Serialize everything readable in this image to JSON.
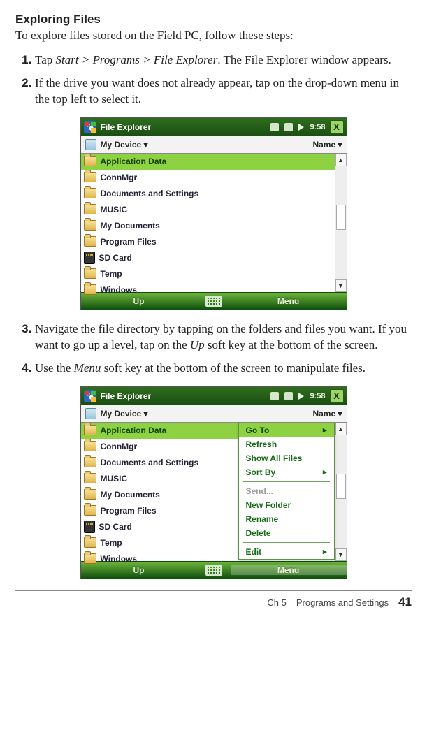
{
  "heading": "Exploring Files",
  "intro": "To explore files stored on the Field PC, follow these steps:",
  "steps": {
    "s1a": "Tap ",
    "s1_path": "Start > Programs > File Explorer",
    "s1b": ". The File Explorer window appears.",
    "s2": "If the drive you want does not already appear, tap on the drop-down menu in the top left to select it.",
    "s3a": "Navigate the file directory by tapping on the folders and files you want. If you want to go up a level, tap on the ",
    "s3_em": "Up",
    "s3b": " soft key at the bottom of the screen.",
    "s4a": "Use the ",
    "s4_em": "Menu",
    "s4b": " soft key at the bottom of the screen to manipulate files."
  },
  "wm": {
    "title": "File Explorer",
    "time": "9:58",
    "close": "X",
    "device": "My Device",
    "sort": "Name",
    "items": [
      "Application Data",
      "ConnMgr",
      "Documents and Settings",
      "MUSIC",
      "My Documents",
      "Program Files",
      "SD Card",
      "Temp",
      "Windows"
    ],
    "up": "Up",
    "menu": "Menu"
  },
  "popup": {
    "goto": "Go To",
    "refresh": "Refresh",
    "showall": "Show All Files",
    "sortby": "Sort By",
    "send": "Send...",
    "newfolder": "New Folder",
    "rename": "Rename",
    "delete": "Delete",
    "edit": "Edit"
  },
  "footer": {
    "chapter": "Ch 5",
    "section": "Programs and Settings",
    "page": "41"
  }
}
